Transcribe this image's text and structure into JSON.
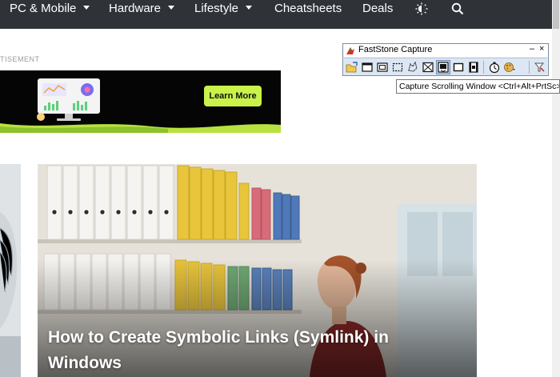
{
  "nav": {
    "items": [
      {
        "label": "PC & Mobile",
        "dropdown": true
      },
      {
        "label": "Hardware",
        "dropdown": true
      },
      {
        "label": "Lifestyle",
        "dropdown": true
      },
      {
        "label": "Cheatsheets",
        "dropdown": false
      },
      {
        "label": "Deals",
        "dropdown": false
      }
    ],
    "icons": [
      "theme-toggle-icon",
      "search-icon"
    ],
    "background": "#2f3338"
  },
  "ad": {
    "label": "TISEMENT",
    "cta_label": "Learn More",
    "accent": "#c9f24a"
  },
  "article": {
    "title": "How to Create Symbolic Links (Symlink) in Windows"
  },
  "faststone": {
    "title": "FastStone Capture",
    "min_glyph": "–",
    "close_glyph": "×",
    "tooltip": "Capture Scrolling Window <Ctrl+Alt+PrtSc>",
    "tools": [
      "open-file-icon",
      "capture-active-window-icon",
      "capture-window-object-icon",
      "capture-rectangular-region-icon",
      "capture-freehand-region-icon",
      "capture-fullscreen-icon",
      "capture-scrolling-window-icon",
      "capture-fixed-region-icon",
      "screen-recorder-icon",
      "delay-timer-icon",
      "output-destination-icon",
      "settings-icon"
    ]
  }
}
